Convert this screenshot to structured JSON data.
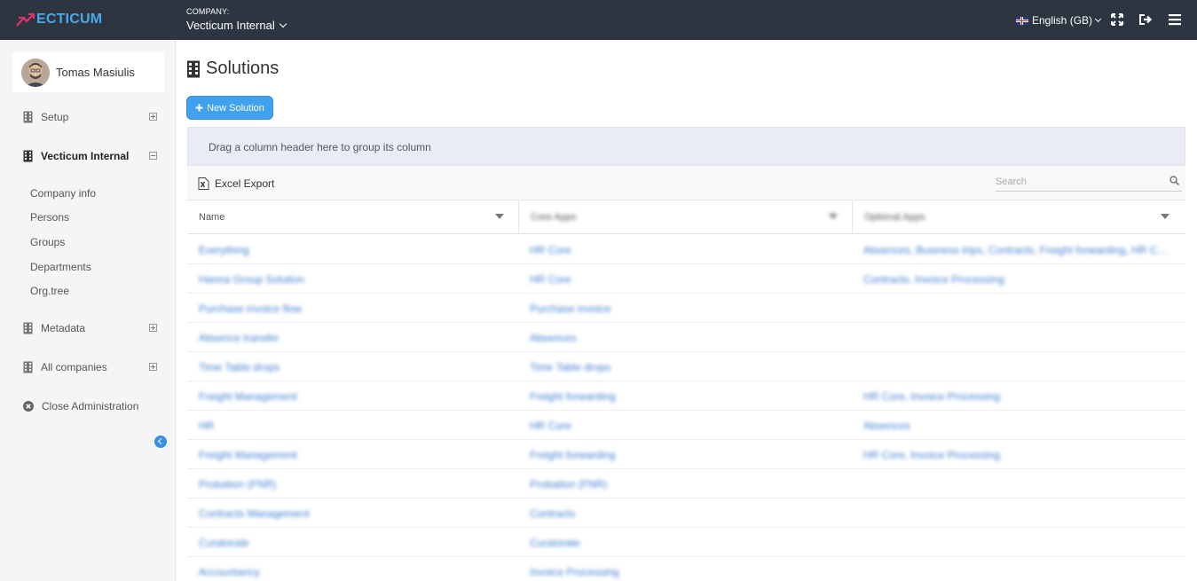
{
  "brand": {
    "logo_text": "ECTICUM",
    "accent": "#4aa9e9",
    "mark_color": "#e0336e"
  },
  "header": {
    "company_label": "COMPANY:",
    "company_name": "Vecticum Internal",
    "language": "English (GB)",
    "icons": [
      "fullscreen-icon",
      "logout-icon",
      "menu-icon"
    ]
  },
  "user": {
    "name": "Tomas Masiulis"
  },
  "sidebar": {
    "items": [
      {
        "label": "Setup",
        "icon": "building-icon",
        "expanded": false
      },
      {
        "label": "Vecticum Internal",
        "icon": "building-icon",
        "expanded": true,
        "active": true
      },
      {
        "label": "Metadata",
        "icon": "building-icon",
        "expanded": false
      },
      {
        "label": "All companies",
        "icon": "building-icon",
        "expanded": false
      },
      {
        "label": "Close Administration",
        "icon": "close-circle-icon"
      }
    ],
    "sub_items": [
      "Company info",
      "Persons",
      "Groups",
      "Departments",
      "Org.tree"
    ]
  },
  "page": {
    "title": "Solutions",
    "new_button": "New Solution",
    "group_hint": "Drag a column header here to group its column",
    "excel_export": "Excel Export",
    "search_placeholder": "Search"
  },
  "grid": {
    "columns": [
      "Name",
      "Core Apps",
      "Optional Apps"
    ],
    "rows": [
      {
        "name": "Everything",
        "core": "HR Core",
        "optional": "Absences, Business trips, Contracts, Freight forwarding, HR Core, I..."
      },
      {
        "name": "Hanna Group Solution",
        "core": "HR Core",
        "optional": "Contracts, Invoice Processing"
      },
      {
        "name": "Purchase invoice flow",
        "core": "Purchase invoice",
        "optional": ""
      },
      {
        "name": "Absence transfer",
        "core": "Absences",
        "optional": ""
      },
      {
        "name": "Time Table drops",
        "core": "Time Table drops",
        "optional": ""
      },
      {
        "name": "Freight Management",
        "core": "Freight forwarding",
        "optional": "HR Core, Invoice Processing"
      },
      {
        "name": "HR",
        "core": "HR Core",
        "optional": "Absences"
      },
      {
        "name": "Freight Management",
        "core": "Freight forwarding",
        "optional": "HR Core, Invoice Processing"
      },
      {
        "name": "Probation (FNR)",
        "core": "Probation (FNR)",
        "optional": ""
      },
      {
        "name": "Contracts Management",
        "core": "Contracts",
        "optional": ""
      },
      {
        "name": "Curatorate",
        "core": "Curatorate",
        "optional": ""
      },
      {
        "name": "Accountancy",
        "core": "Invoice Processing",
        "optional": ""
      }
    ]
  }
}
